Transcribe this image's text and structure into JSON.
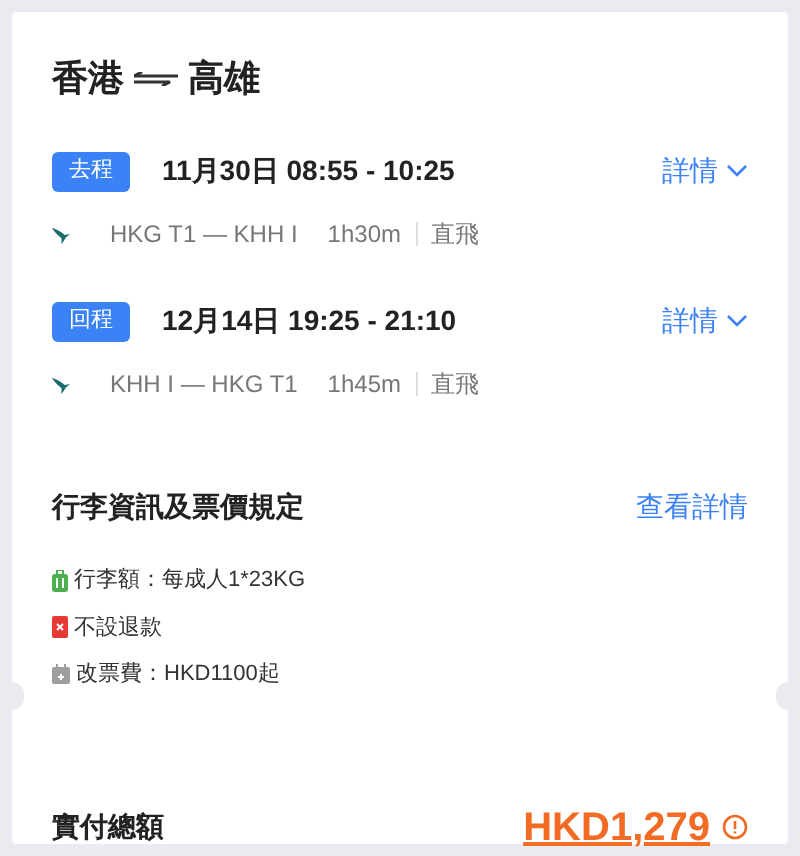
{
  "route": {
    "from": "香港",
    "to": "高雄"
  },
  "segments": [
    {
      "tag": "去程",
      "datetime": "11月30日 08:55 - 10:25",
      "details": "詳情",
      "path": "HKG T1 — KHH I",
      "duration": "1h30m",
      "type": "直飛"
    },
    {
      "tag": "回程",
      "datetime": "12月14日 19:25 - 21:10",
      "details": "詳情",
      "path": "KHH I — HKG T1",
      "duration": "1h45m",
      "type": "直飛"
    }
  ],
  "rules_section": {
    "title": "行李資訊及票價規定",
    "link": "查看詳情",
    "rules": [
      {
        "kind": "baggage",
        "text": "行李額：每成人1*23KG"
      },
      {
        "kind": "no-refund",
        "text": "不設退款"
      },
      {
        "kind": "change",
        "text": "改票費：HKD1100起"
      }
    ]
  },
  "total": {
    "label": "實付總額",
    "amount": "HKD1,279"
  }
}
